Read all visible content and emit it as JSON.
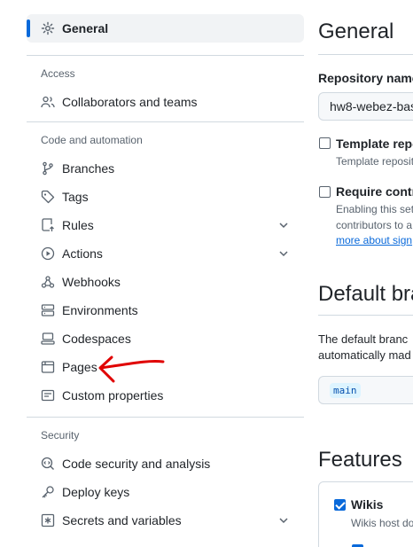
{
  "sidebar": {
    "general": "General",
    "groups": {
      "access": "Access",
      "code_automation": "Code and automation",
      "security": "Security"
    },
    "items": {
      "collaborators": "Collaborators and teams",
      "branches": "Branches",
      "tags": "Tags",
      "rules": "Rules",
      "actions": "Actions",
      "webhooks": "Webhooks",
      "environments": "Environments",
      "codespaces": "Codespaces",
      "pages": "Pages",
      "custom_properties": "Custom properties",
      "code_security": "Code security and analysis",
      "deploy_keys": "Deploy keys",
      "secrets": "Secrets and variables"
    }
  },
  "main": {
    "title": "General",
    "repo_name_label": "Repository name",
    "repo_name_value": "hw8-webez-bas",
    "template_label": "Template repo",
    "template_desc": "Template reposit",
    "require_label": "Require contri",
    "require_desc_1": "Enabling this set",
    "require_desc_2": "contributors to a",
    "require_link": "more about sign",
    "default_branch_title": "Default bra",
    "default_branch_desc_1": "The default branc",
    "default_branch_desc_2": "automatically mad",
    "default_branch_value": "main",
    "features_title": "Features",
    "wikis_label": "Wikis",
    "wikis_desc": "Wikis host do"
  },
  "colors": {
    "accent": "#0969da",
    "annotation_arrow": "#e00000"
  }
}
